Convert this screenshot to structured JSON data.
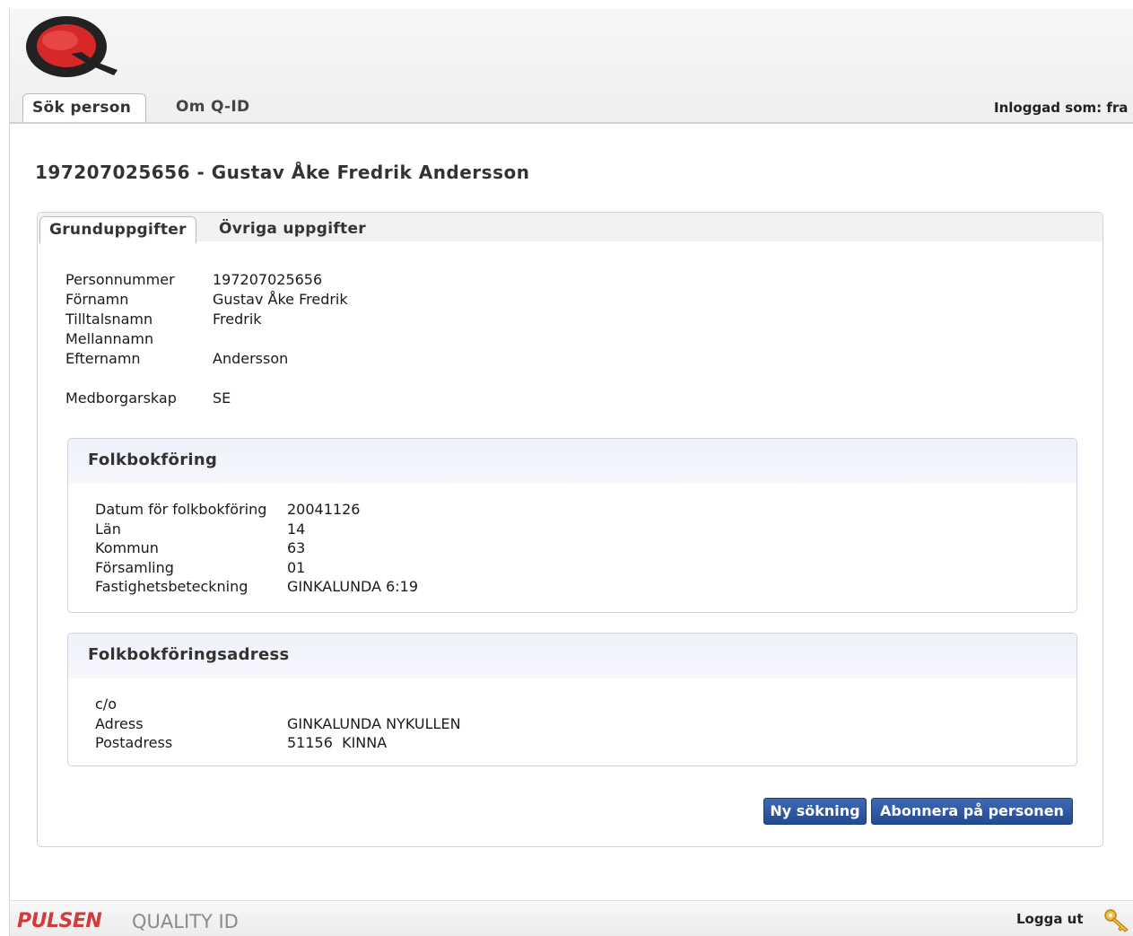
{
  "header": {
    "logo": "q-logo",
    "nav_tabs": [
      "Sök person",
      "Om Q-ID"
    ],
    "logged_in": "Inloggad som: fra"
  },
  "person": {
    "title": "197207025656 - Gustav Åke Fredrik Andersson",
    "tabs": [
      "Grunduppgifter",
      "Övriga uppgifter"
    ],
    "fields": [
      {
        "label": "Personnummer",
        "value": "197207025656"
      },
      {
        "label": "Förnamn",
        "value": "Gustav Åke Fredrik"
      },
      {
        "label": "Tilltalsnamn",
        "value": "Fredrik"
      },
      {
        "label": "Mellannamn",
        "value": ""
      },
      {
        "label": "Efternamn",
        "value": "Andersson"
      },
      {
        "label": "Medborgarskap",
        "value": "SE"
      }
    ]
  },
  "folkbokforing": {
    "title": "Folkbokföring",
    "rows": [
      {
        "label": "Datum för folkbokföring",
        "value": "20041126"
      },
      {
        "label": "Län",
        "value": "14"
      },
      {
        "label": "Kommun",
        "value": "63"
      },
      {
        "label": "Församling",
        "value": "01"
      },
      {
        "label": "Fastighetsbeteckning",
        "value": "GINKALUNDA 6:19"
      }
    ]
  },
  "adress": {
    "title": "Folkbokföringsadress",
    "rows": [
      {
        "label": "c/o",
        "value": ""
      },
      {
        "label": "Adress",
        "value": "GINKALUNDA NYKULLEN"
      },
      {
        "label": "Postadress",
        "value": "51156  KINNA"
      }
    ]
  },
  "actions": {
    "new_search": "Ny sökning",
    "subscribe": "Abonnera på personen"
  },
  "footer": {
    "brand": "PULSEN",
    "product": "QUALITY ID",
    "logout": "Logga ut",
    "logout_icon": "key-icon"
  },
  "colors": {
    "button": "#2c5aa8",
    "brand": "#d13b3b",
    "logo_red": "#d62828"
  }
}
